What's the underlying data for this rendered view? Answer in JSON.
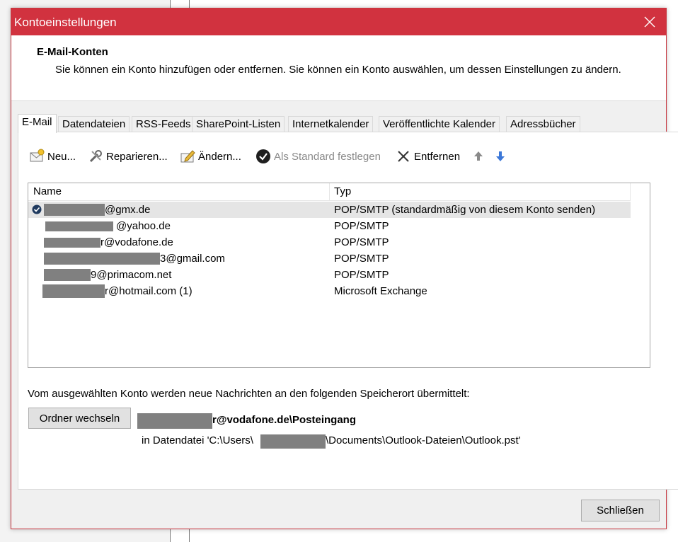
{
  "dialog": {
    "title": "Kontoeinstellungen",
    "heading": "E-Mail-Konten",
    "description": "Sie können ein Konto hinzufügen oder entfernen. Sie können ein Konto auswählen, um dessen Einstellungen zu ändern."
  },
  "tabs": [
    "E-Mail",
    "Datendateien",
    "RSS-Feeds",
    "SharePoint-Listen",
    "Internetkalender",
    "Veröffentlichte Kalender",
    "Adressbücher"
  ],
  "toolbar": {
    "new": "Neu...",
    "repair": "Reparieren...",
    "change": "Ändern...",
    "set_default": "Als Standard festlegen",
    "remove": "Entfernen"
  },
  "list": {
    "columns": [
      "Name",
      "Typ"
    ],
    "rows": [
      {
        "name": "@gmx.de",
        "type": "POP/SMTP (standardmäßig von diesem Konto senden)"
      },
      {
        "name": "@yahoo.de",
        "type": "POP/SMTP"
      },
      {
        "name": "r@vodafone.de",
        "type": "POP/SMTP"
      },
      {
        "name": "3@gmail.com",
        "type": "POP/SMTP"
      },
      {
        "name": "9@primacom.net",
        "type": "POP/SMTP"
      },
      {
        "name": "r@hotmail.com (1)",
        "type": "Microsoft Exchange"
      }
    ]
  },
  "delivery": {
    "info_text": "Vom ausgewählten Konto werden neue Nachrichten an den folgenden Speicherort übermittelt:",
    "change_folder_button": "Ordner wechseln",
    "location_main": "r@vodafone.de\\Posteingang",
    "location_prefix": "in Datendatei 'C:\\Users\\",
    "location_suffix": "\\Documents\\Outlook-Dateien\\Outlook.pst'"
  },
  "footer": {
    "close_button": "Schließen"
  },
  "colors": {
    "titlebar": "#d1323f",
    "redaction": "#808080"
  }
}
